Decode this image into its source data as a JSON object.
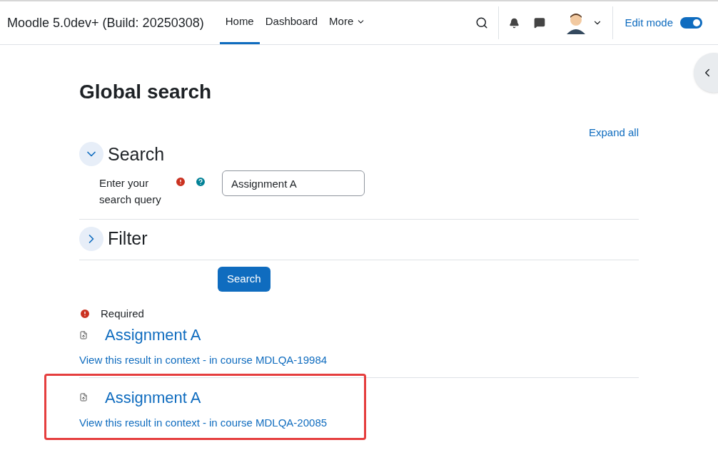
{
  "site_name": "Moodle 5.0dev+ (Build: 20250308)",
  "nav": [
    {
      "label": "Home",
      "selected": true,
      "kind": "link"
    },
    {
      "label": "Dashboard",
      "selected": false,
      "kind": "link"
    },
    {
      "label": "More",
      "selected": false,
      "kind": "dropdown"
    }
  ],
  "edit_mode": {
    "label": "Edit mode",
    "on": true
  },
  "page_title": "Global search",
  "expand_all": "Expand all",
  "sections": [
    {
      "title": "Search",
      "expanded": true
    },
    {
      "title": "Filter",
      "expanded": false
    }
  ],
  "query_field": {
    "label": "Enter your search query",
    "value": "Assignment A"
  },
  "search_button": "Search",
  "required_note": "Required",
  "results": [
    {
      "title": "Assignment A",
      "context_link": "View this result in context",
      "separator": "-",
      "course_link": "in course MDLQA-19984",
      "highlighted": false
    },
    {
      "title": "Assignment A",
      "context_link": "View this result in context",
      "separator": "-",
      "course_link": "in course MDLQA-20085",
      "highlighted": true
    }
  ]
}
